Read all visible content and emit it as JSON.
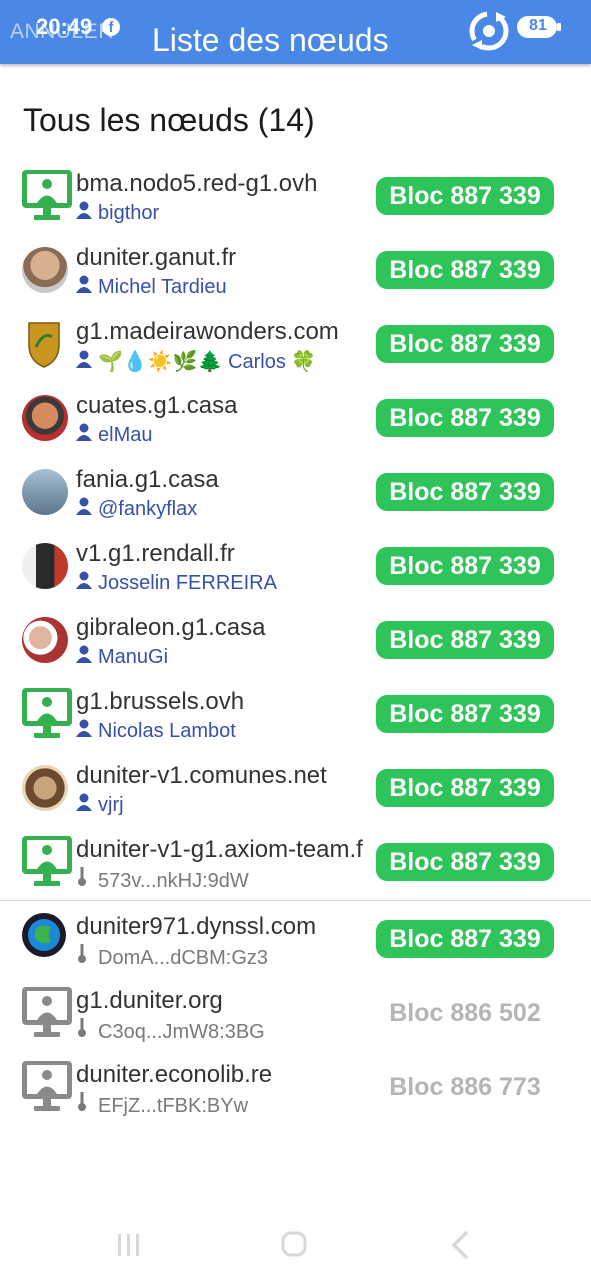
{
  "status_bar": {
    "time": "20:49",
    "fb_glyph": "f",
    "battery": "81"
  },
  "header": {
    "cancel_label": "ANNULER",
    "title": "Liste des nœuds",
    "sync_icon": "sync-icon"
  },
  "section": {
    "title": "Tous les nœuds (14)"
  },
  "colors": {
    "appbar": "#4a88e8",
    "synced_badge": "#2fc45a",
    "stale_text": "#b5b5b5",
    "user_link": "#3750a8",
    "monitor_green": "#34b050",
    "monitor_grey": "#8a8a8a"
  },
  "nodes": [
    {
      "host": "bma.nodo5.red-g1.ovh",
      "sub": "bigthor",
      "sub_type": "user",
      "icon": "monitor-green-icon",
      "block": "Bloc 887 339",
      "synced": true
    },
    {
      "host": "duniter.ganut.fr",
      "sub": "Michel Tardieu",
      "sub_type": "user",
      "icon": "avatar",
      "block": "Bloc 887 339",
      "synced": true
    },
    {
      "host": "g1.madeirawonders.com",
      "sub": "🌱💧☀️🌿🌲 Carlos 🍀",
      "sub_type": "user",
      "icon": "shield-avatar",
      "block": "Bloc 887 339",
      "synced": true
    },
    {
      "host": "cuates.g1.casa",
      "sub": "elMau",
      "sub_type": "user",
      "icon": "avatar",
      "block": "Bloc 887 339",
      "synced": true
    },
    {
      "host": "fania.g1.casa",
      "sub": "@fankyflax",
      "sub_type": "user",
      "icon": "avatar",
      "block": "Bloc 887 339",
      "synced": true
    },
    {
      "host": "v1.g1.rendall.fr",
      "sub": "Josselin FERREIRA",
      "sub_type": "user",
      "icon": "avatar",
      "block": "Bloc 887 339",
      "synced": true
    },
    {
      "host": "gibraleon.g1.casa",
      "sub": "ManuGi",
      "sub_type": "user",
      "icon": "avatar",
      "block": "Bloc 887 339",
      "synced": true
    },
    {
      "host": "g1.brussels.ovh",
      "sub": "Nicolas Lambot",
      "sub_type": "user",
      "icon": "monitor-green-icon",
      "block": "Bloc 887 339",
      "synced": true
    },
    {
      "host": "duniter-v1.comunes.net",
      "sub": "vjrj",
      "sub_type": "user",
      "icon": "avatar",
      "block": "Bloc 887 339",
      "synced": true
    },
    {
      "host": "duniter-v1-g1.axiom-team.f",
      "sub": "573v...nkHJ:9dW",
      "sub_type": "key",
      "icon": "monitor-green-icon",
      "block": "Bloc 887 339",
      "synced": true
    },
    {
      "host": "duniter971.dynssl.com",
      "sub": "DomA...dCBM:Gz3",
      "sub_type": "key",
      "icon": "globe-avatar",
      "block": "Bloc 887 339",
      "synced": true
    },
    {
      "host": "g1.duniter.org",
      "sub": "C3oq...JmW8:3BG",
      "sub_type": "key",
      "icon": "monitor-grey-icon",
      "block": "Bloc 886 502",
      "synced": false
    },
    {
      "host": "duniter.econolib.re",
      "sub": "EFjZ...tFBK:BYw",
      "sub_type": "key",
      "icon": "monitor-grey-icon",
      "block": "Bloc 886 773",
      "synced": false
    }
  ]
}
